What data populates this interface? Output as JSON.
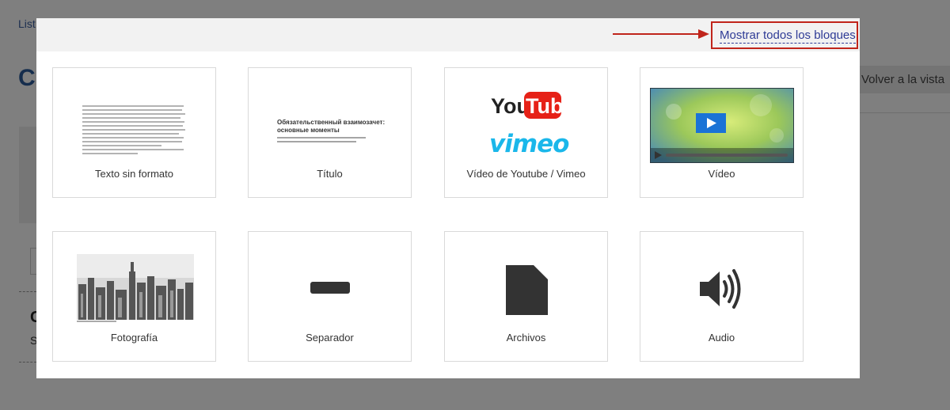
{
  "background": {
    "top_link": "List",
    "page_title": "C",
    "back_button": "Volver a la vista",
    "section_heading": "C",
    "section_text": "S"
  },
  "modal": {
    "show_all_link": "Mostrar todos los bloques",
    "blocks": [
      {
        "label": "Texto sin formato",
        "icon": "plain-text-preview"
      },
      {
        "label": "Título",
        "icon": "title-preview",
        "preview_heading": "Обязательственный взаимозачет: основные моменты"
      },
      {
        "label": "Vídeo de Youtube / Vimeo",
        "icon": "youtube-vimeo-logos",
        "logo_youtube_you": "You",
        "logo_youtube_tube": "Tube",
        "logo_vimeo": "vimeo"
      },
      {
        "label": "Vídeo",
        "icon": "video-player-preview"
      },
      {
        "label": "Fotografía",
        "icon": "city-photo-preview"
      },
      {
        "label": "Separador",
        "icon": "separator-icon"
      },
      {
        "label": "Archivos",
        "icon": "file-icon"
      },
      {
        "label": "Audio",
        "icon": "speaker-icon"
      }
    ]
  },
  "colors": {
    "highlight_border": "#c0251b",
    "link": "#2e3b96",
    "youtube_red": "#e62117",
    "vimeo_blue": "#1ab7ea",
    "icon_dark": "#333333"
  }
}
